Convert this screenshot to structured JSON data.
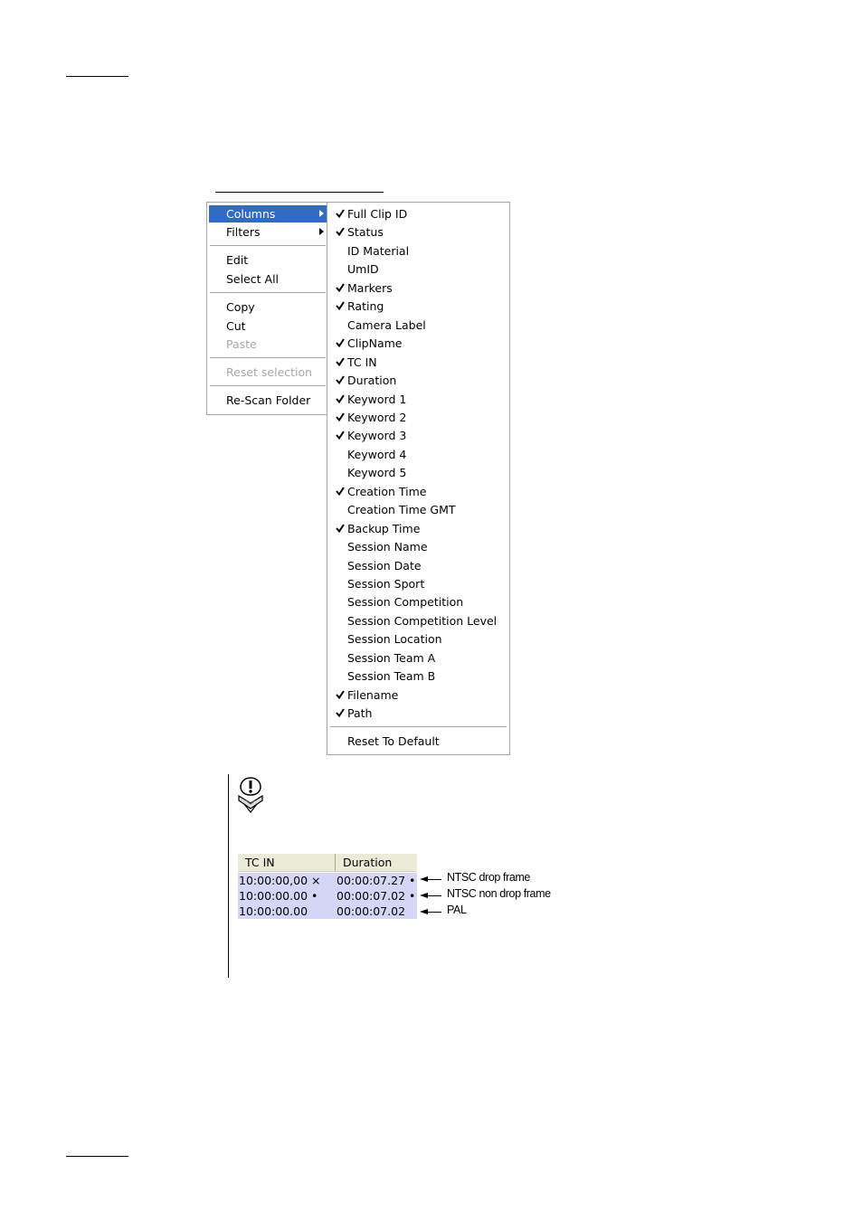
{
  "context_menu": {
    "items": [
      {
        "label": "Columns",
        "selected": true,
        "submenu": true,
        "disabled": false
      },
      {
        "label": "Filters",
        "selected": false,
        "submenu": true,
        "disabled": false
      },
      {
        "label": "Edit",
        "selected": false,
        "submenu": false,
        "disabled": false
      },
      {
        "label": "Select All",
        "selected": false,
        "submenu": false,
        "disabled": false
      },
      {
        "label": "Copy",
        "selected": false,
        "submenu": false,
        "disabled": false
      },
      {
        "label": "Cut",
        "selected": false,
        "submenu": false,
        "disabled": false
      },
      {
        "label": "Paste",
        "selected": false,
        "submenu": false,
        "disabled": true
      },
      {
        "label": "Reset selection",
        "selected": false,
        "submenu": false,
        "disabled": true
      },
      {
        "label": "Re-Scan Folder",
        "selected": false,
        "submenu": false,
        "disabled": false
      }
    ]
  },
  "columns_submenu": {
    "items": [
      {
        "label": "Full Clip ID",
        "checked": true
      },
      {
        "label": "Status",
        "checked": true
      },
      {
        "label": "ID Material",
        "checked": false
      },
      {
        "label": "UmID",
        "checked": false
      },
      {
        "label": "Markers",
        "checked": true
      },
      {
        "label": "Rating",
        "checked": true
      },
      {
        "label": "Camera Label",
        "checked": false
      },
      {
        "label": "ClipName",
        "checked": true
      },
      {
        "label": "TC IN",
        "checked": true
      },
      {
        "label": "Duration",
        "checked": true
      },
      {
        "label": "Keyword 1",
        "checked": true
      },
      {
        "label": "Keyword 2",
        "checked": true
      },
      {
        "label": "Keyword 3",
        "checked": true
      },
      {
        "label": "Keyword 4",
        "checked": false
      },
      {
        "label": "Keyword 5",
        "checked": false
      },
      {
        "label": "Creation Time",
        "checked": true
      },
      {
        "label": "Creation Time GMT",
        "checked": false
      },
      {
        "label": "Backup Time",
        "checked": true
      },
      {
        "label": "Session Name",
        "checked": false
      },
      {
        "label": "Session Date",
        "checked": false
      },
      {
        "label": "Session Sport",
        "checked": false
      },
      {
        "label": "Session Competition",
        "checked": false
      },
      {
        "label": "Session Competition Level",
        "checked": false
      },
      {
        "label": "Session Location",
        "checked": false
      },
      {
        "label": "Session Team A",
        "checked": false
      },
      {
        "label": "Session Team B",
        "checked": false
      },
      {
        "label": "Filename",
        "checked": true
      },
      {
        "label": "Path",
        "checked": true
      }
    ],
    "reset_label": "Reset To Default"
  },
  "timecode_table": {
    "headers": [
      "TC IN",
      "Duration"
    ],
    "rows": [
      {
        "tc_in": "10:00:00,00 ×",
        "duration": "00:00:07.27 •",
        "annotation": "NTSC drop frame"
      },
      {
        "tc_in": "10:00:00.00 •",
        "duration": "00:00:07.02 •",
        "annotation": "NTSC non drop frame"
      },
      {
        "tc_in": "10:00:00.00",
        "duration": "00:00:07.02",
        "annotation": "PAL"
      }
    ]
  },
  "colors": {
    "selection": "#316ac5",
    "menu_border": "#a5a5a5",
    "disabled_text": "#a7a7a7",
    "row_highlight": "#d5d5f5",
    "header_bg": "#ecebd9"
  },
  "icons": {
    "note": "important-note-icon",
    "check": "checkmark-icon",
    "submenu": "submenu-arrow-icon"
  }
}
